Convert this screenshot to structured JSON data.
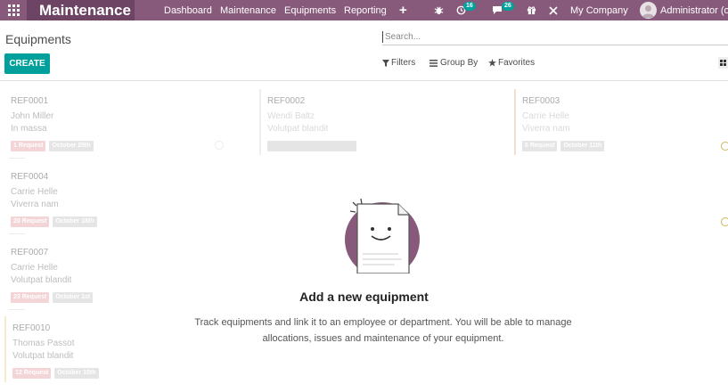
{
  "navbar": {
    "app_name": "Maintenance",
    "menu": [
      "Dashboard",
      "Maintenance",
      "Equipments",
      "Reporting"
    ],
    "activity_badge": "16",
    "messages_badge": "26",
    "company": "My Company",
    "user": "Administrator (od"
  },
  "control_panel": {
    "title": "Equipments",
    "search_placeholder": "Search...",
    "create_label": "CREATE",
    "filters_label": "Filters",
    "groupby_label": "Group By",
    "favorites_label": "Favorites"
  },
  "cards": [
    {
      "ref": "REF0001",
      "owner": "John Miller",
      "model": "In massa",
      "requests": "1 Request",
      "date": "October 25th"
    },
    {
      "ref": "REF0002",
      "owner": "Wendi Baltz",
      "model": "Volutpat blandit",
      "requests": "",
      "date": ""
    },
    {
      "ref": "REF0003",
      "owner": "Carrie Helle",
      "model": "Viverra nam",
      "requests": "6 Request",
      "date": "October 11th"
    },
    {
      "ref": "REF0004",
      "owner": "Carrie Helle",
      "model": "Viverra nam",
      "requests": "20 Request",
      "date": "October 18th"
    },
    {
      "ref": "REF0007",
      "owner": "Carrie Helle",
      "model": "Volutpat blandit",
      "requests": "23 Request",
      "date": "October 1st"
    },
    {
      "ref": "REF0010",
      "owner": "Thomas Passot",
      "model": "Volutpat blandit",
      "requests": "12 Request",
      "date": "October 10th"
    }
  ],
  "helper": {
    "title": "Add a new equipment",
    "line1": "Track equipments and link it to an employee or department. You will be able to manage",
    "line2": "allocations, issues and maintenance of your equipment."
  },
  "colors": {
    "brand": "#875a7b",
    "brand_dark": "#6d4464",
    "accent": "#00a09d"
  }
}
